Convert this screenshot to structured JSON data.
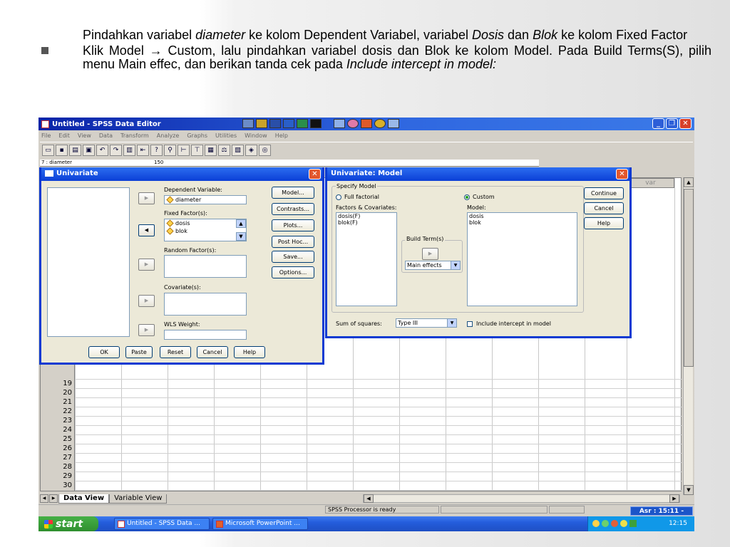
{
  "slide": {
    "para1": {
      "a": "Pindahkan variabel ",
      "b": "diameter",
      "c": " ke kolom Dependent Variabel, variabel ",
      "d": "Dosis",
      "e": " dan ",
      "f": "Blok",
      "g": " ke kolom Fixed Factor"
    },
    "para2": {
      "a": "Klik Model ",
      "arrow": "→",
      "b": "  Custom, lalu pindahkan variabel dosis dan Blok ke kolom Model. Pada Build Terms(S), pilih menu Main effec, dan berikan tanda cek pada ",
      "c": "Include intercept in model:"
    }
  },
  "app": {
    "title": "Untitled - SPSS Data Editor",
    "menu": [
      "File",
      "Edit",
      "View",
      "Data",
      "Transform",
      "Analyze",
      "Graphs",
      "Utilities",
      "Window",
      "Help"
    ],
    "cell_ref": "7 : diameter",
    "cell_value": "150",
    "var_header": "var",
    "row_numbers": [
      "19",
      "20",
      "21",
      "22",
      "23",
      "24",
      "25",
      "26",
      "27",
      "28",
      "29",
      "30"
    ],
    "tabs": {
      "data_view": "Data View",
      "variable_view": "Variable View"
    },
    "status": "SPSS Processor  is ready",
    "asr": "Asr : 15:11 -"
  },
  "univariate": {
    "title": "Univariate",
    "dependent_label": "Dependent Variable:",
    "dependent_value": "diameter",
    "fixed_label": "Fixed Factor(s):",
    "fixed_values": [
      "dosis",
      "blok"
    ],
    "random_label": "Random Factor(s):",
    "covariate_label": "Covariate(s):",
    "wls_label": "WLS Weight:",
    "side_buttons": [
      "Model...",
      "Contrasts...",
      "Plots...",
      "Post Hoc...",
      "Save...",
      "Options..."
    ],
    "bottom_buttons": [
      "OK",
      "Paste",
      "Reset",
      "Cancel",
      "Help"
    ]
  },
  "model_dialog": {
    "title": "Univariate: Model",
    "specify_label": "Specify Model",
    "full_factorial": "Full factorial",
    "custom": "Custom",
    "factors_label": "Factors & Covariates:",
    "factors": [
      "dosis(F)",
      "blok(F)"
    ],
    "model_label": "Model:",
    "model_items": [
      "dosis",
      "blok"
    ],
    "build_term_label": "Build Term(s)",
    "build_term_value": "Main effects",
    "sum_label": "Sum of squares:",
    "sum_value": "Type III",
    "intercept_label": "Include intercept in model",
    "buttons": [
      "Continue",
      "Cancel",
      "Help"
    ]
  },
  "taskbar": {
    "start": "start",
    "items": [
      "Untitled - SPSS Data ...",
      "Microsoft PowerPoint ..."
    ],
    "clock": "12:15"
  },
  "colors": {
    "title_blue": "#0a24a8",
    "dialog_border": "#0a3ad2",
    "start_green": "#2f8f2f"
  }
}
